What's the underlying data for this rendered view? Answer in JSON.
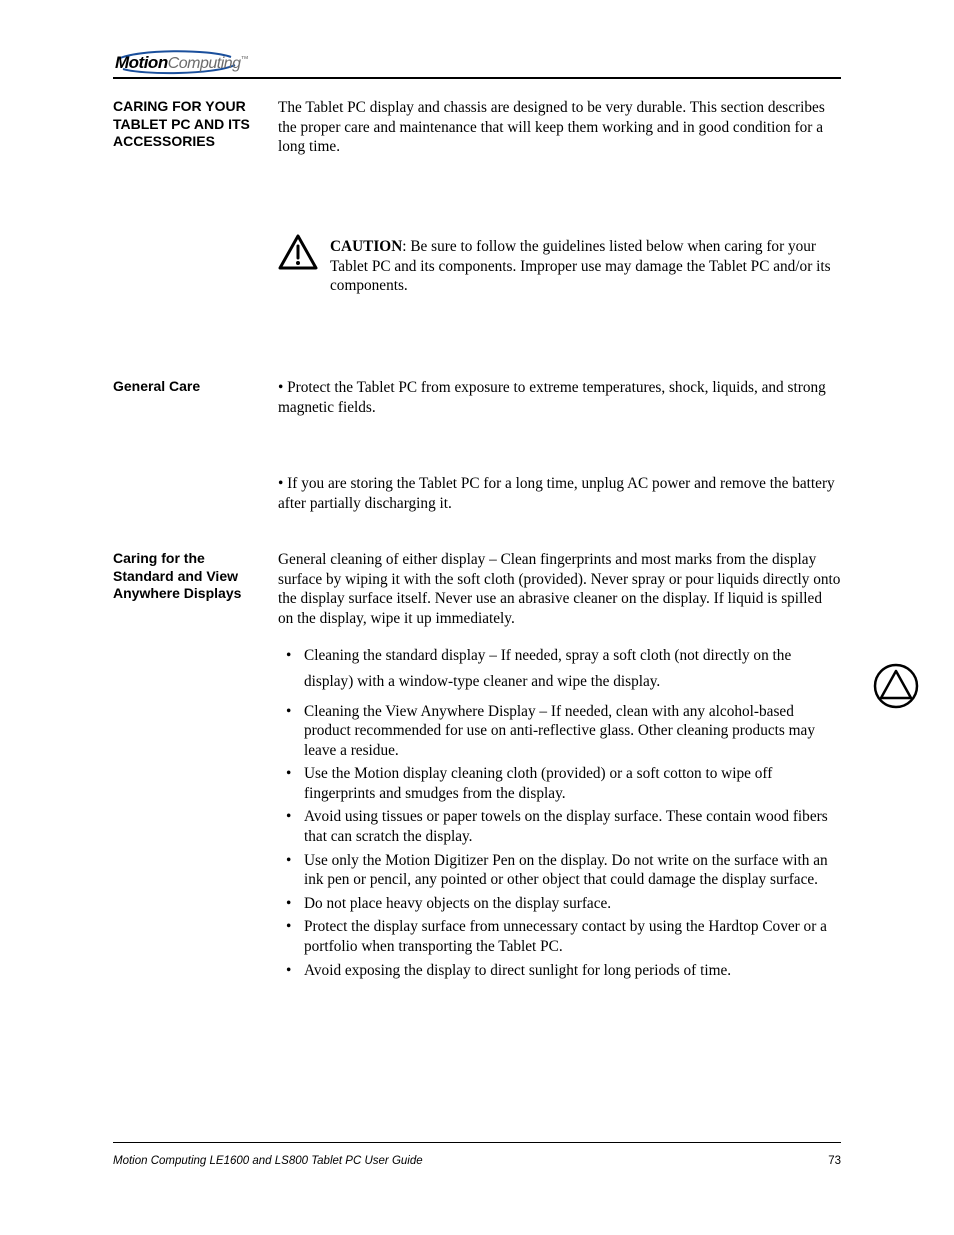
{
  "brand": {
    "motion": "Motion",
    "computing": "Computing",
    "tm": "™"
  },
  "sections": {
    "s1": {
      "heading": "CARING FOR YOUR TABLET PC AND ITS ACCESSORIES",
      "para1_a": "The Tablet PC display and chassis are designed to be very durable. This section describes the proper care and maintenance that will keep them working and in good condition for a long time.",
      "warning_label": "CAUTION",
      "warning_body": ": Be sure to follow the guidelines listed below when caring for your Tablet PC and its components. Improper use may damage the Tablet PC and/or its components."
    },
    "s2": {
      "heading": "General Care",
      "para_a": "• Protect the Tablet PC from exposure to extreme temperatures, shock, liquids, and strong magnetic fields.",
      "para_b": "• If you are storing the Tablet PC for a long time, unplug AC power and remove the battery after partially discharging it."
    },
    "s3": {
      "heading": "Caring for the Standard and View Anywhere Displays",
      "para_a": "General cleaning of either display – Clean fingerprints and most marks from the display surface by wiping it with the soft cloth (provided). Never spray or pour liquids directly onto the display surface itself. Never use an abrasive cleaner on the display. If liquid is spilled on the display, wipe it up immediately.",
      "list": {
        "i1_a": "Cleaning the standard display – If needed, spray a soft cloth (not directly on the display) with a window-type cleaner and wipe the display. ",
        "i1_b": "",
        "i2": "Cleaning the View Anywhere Display – If needed, clean with any alcohol-based product recommended for use on anti-reflective glass. Other cleaning products may leave a residue.",
        "i3": "Use the Motion display cleaning cloth (provided) or a soft cotton to wipe off fingerprints and smudges from the display.",
        "i4": "Avoid using tissues or paper towels on the display surface. These contain wood fibers that can scratch the display.",
        "i5": "Use only the Motion Digitizer Pen on the display. Do not write on the surface with an ink pen or pencil, any pointed or other object that could damage the display surface.",
        "i6": "Do not place heavy objects on the display surface.",
        "i7": "Protect the display surface from unnecessary contact by using the Hardtop Cover or a portfolio when transporting the Tablet PC.",
        "i8": "Avoid exposing the display to direct sunlight for long periods of time."
      },
      "circle_alt": "circle-triangle-icon"
    }
  },
  "footer": {
    "left": "Motion Computing LE1600 and LS800 Tablet PC User Guide",
    "right": "73"
  }
}
